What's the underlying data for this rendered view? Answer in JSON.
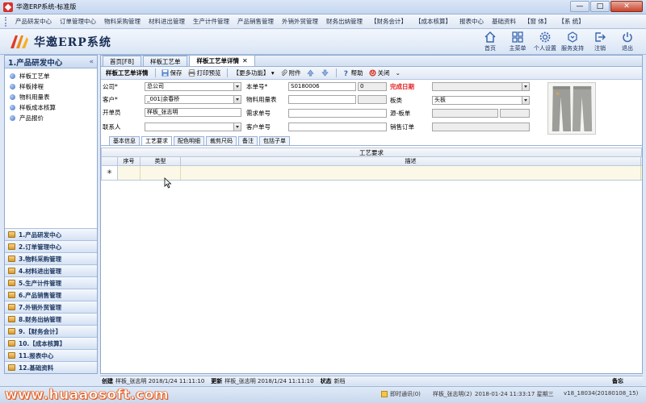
{
  "window": {
    "title": "华邀ERP系统-标准版",
    "controls": [
      "—",
      "□",
      "✕"
    ]
  },
  "menu": [
    "产品研发中心",
    "订单管理中心",
    "物料采购管理",
    "材料进出管理",
    "生产计件管理",
    "产品销售管理",
    "外销外贸管理",
    "财务出纳管理",
    "【财务会计】",
    "【成本核算】",
    "报表中心",
    "基础资料",
    "【窗 体】",
    "【系 统】"
  ],
  "header": {
    "brand": "华邀ERP系统",
    "tools": [
      {
        "label": "首页",
        "icon": "home-icon"
      },
      {
        "label": "主菜单",
        "icon": "menu-icon"
      },
      {
        "label": "个人设置",
        "icon": "gear-icon"
      },
      {
        "label": "服务支持",
        "icon": "support-icon"
      },
      {
        "label": "注销",
        "icon": "logout-icon"
      },
      {
        "label": "退出",
        "icon": "power-icon"
      }
    ]
  },
  "sidebar": {
    "title": "1.产品研发中心",
    "collapse": "«",
    "items": [
      "样板工艺单",
      "样板排程",
      "物料用量表",
      "样板成本核算",
      "产品报价"
    ],
    "modules": [
      "1.产品研发中心",
      "2.订单管理中心",
      "3.物料采购管理",
      "4.材料进出管理",
      "5.生产计件管理",
      "6.产品销售管理",
      "7.外销外贸管理",
      "8.财务出纳管理",
      "9.【财务会计】",
      "10.【成本核算】",
      "11.报表中心",
      "12.基础资料"
    ]
  },
  "tabs": [
    {
      "label": "首页[F8]"
    },
    {
      "label": "样板工艺单"
    },
    {
      "label": "样板工艺单详情",
      "close": "✕"
    }
  ],
  "toolbar": {
    "title": "样板工艺单详情",
    "save": "保存",
    "print": "打印预览",
    "more": "【更多功能】",
    "attach": "附件",
    "help": "帮助",
    "close": "关闭"
  },
  "form": {
    "company_label": "公司*",
    "company_value": "总公司",
    "customer_label": "客户*",
    "customer_value": "_001|余春桥",
    "creator_label": "开单员",
    "creator_value": "样板_张志明",
    "contact_label": "联系人",
    "contact_value": "",
    "doc_no_label": "本单号*",
    "doc_no_value": "S0180006",
    "doc_no_count": "0",
    "material_label": "物料用量表",
    "demand_label": "需求单号",
    "cust_no_label": "客户单号",
    "finish_label": "完成日期",
    "pattern_label": "板类",
    "pattern_value": "头板",
    "source_label": "源-板单",
    "sales_label": "销售订单"
  },
  "subtabs": [
    "基本信息",
    "工艺要求",
    "配色明细",
    "裁剪尺码",
    "备注",
    "包括子单"
  ],
  "grid": {
    "title": "工艺要求",
    "columns": [
      "序号",
      "类型",
      "描述"
    ],
    "new_row_marker": "✳"
  },
  "status": {
    "created_label": "创建",
    "created_value": "样板_张志明 2018/1/24 11:11:10",
    "updated_label": "更新",
    "updated_value": "样板_张志明 2018/1/24 11:11:10",
    "state_label": "状态",
    "state_value": "新档",
    "note": "备忘"
  },
  "footer": {
    "watermark": "www.huaaosoft.com",
    "chat": "即时通讯(0)",
    "user": "样板_张志明(2)",
    "datetime": "2018-01-24  11:33:17  星期三",
    "version": "v18_18034(20180108_15)"
  }
}
